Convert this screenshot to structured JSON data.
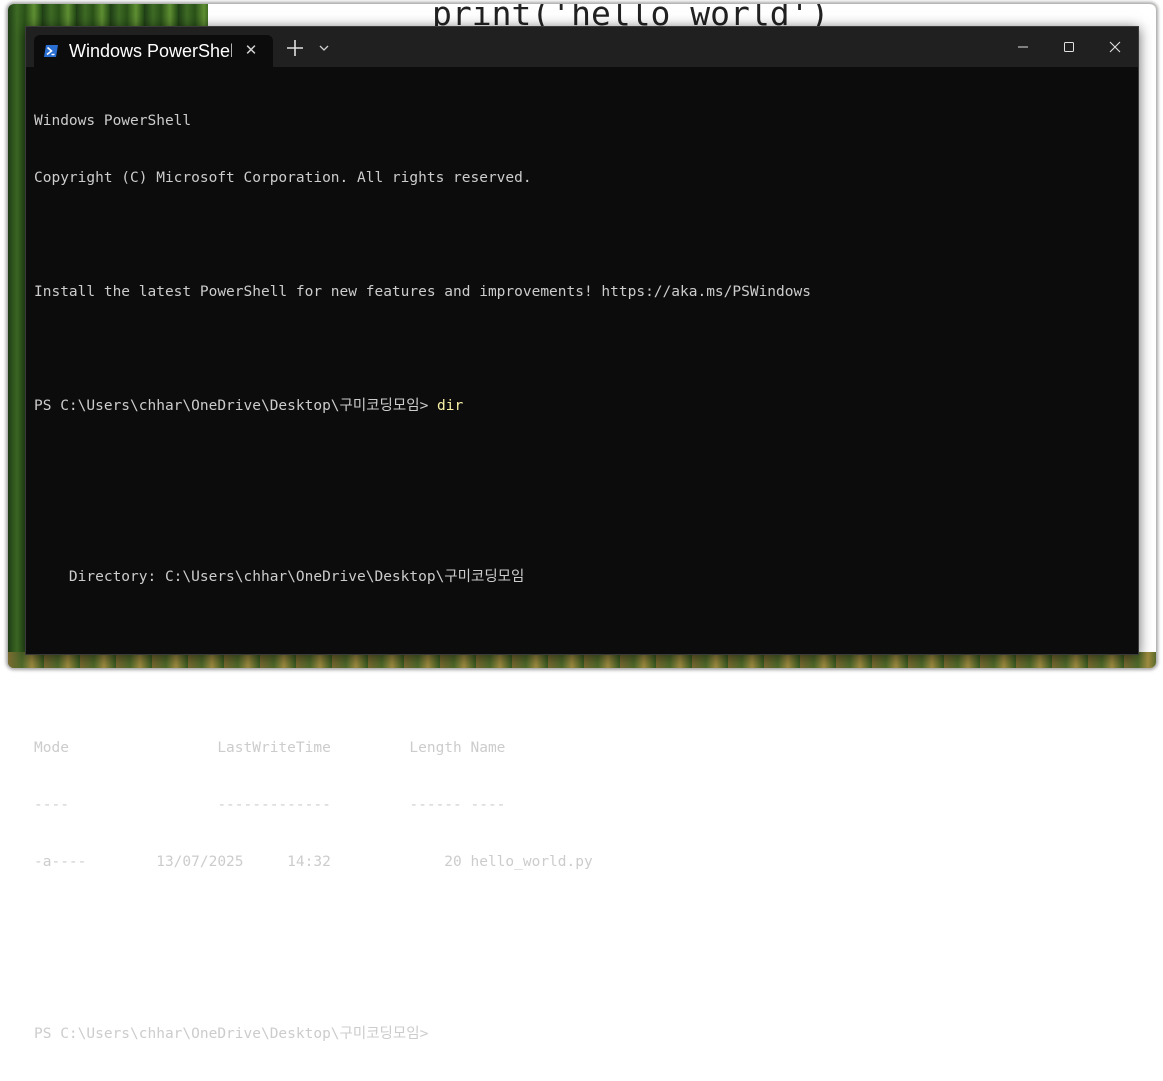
{
  "background": {
    "editor_code": "print('hello world')",
    "stray_letter": "w"
  },
  "window": {
    "tab_title": "Windows PowerShell",
    "tab_icon": "powershell-icon",
    "colors": {
      "console_bg": "#0c0c0c",
      "text": "#cccccc",
      "command": "#f9f1a5",
      "titlebar": "#202020"
    }
  },
  "console": {
    "banner_1": "Windows PowerShell",
    "banner_2": "Copyright (C) Microsoft Corporation. All rights reserved.",
    "install_msg": "Install the latest PowerShell for new features and improvements! https://aka.ms/PSWindows",
    "prompt_1": "PS C:\\Users\\chhar\\OneDrive\\Desktop\\구미코딩모임> ",
    "command_1": "dir",
    "directory_line": "    Directory: C:\\Users\\chhar\\OneDrive\\Desktop\\구미코딩모임",
    "header": "Mode                 LastWriteTime         Length Name",
    "separator": "----                 -------------         ------ ----",
    "row_1": "-a----        13/07/2025     14:32             20 hello_world.py",
    "prompt_2": "PS C:\\Users\\chhar\\OneDrive\\Desktop\\구미코딩모임> "
  }
}
